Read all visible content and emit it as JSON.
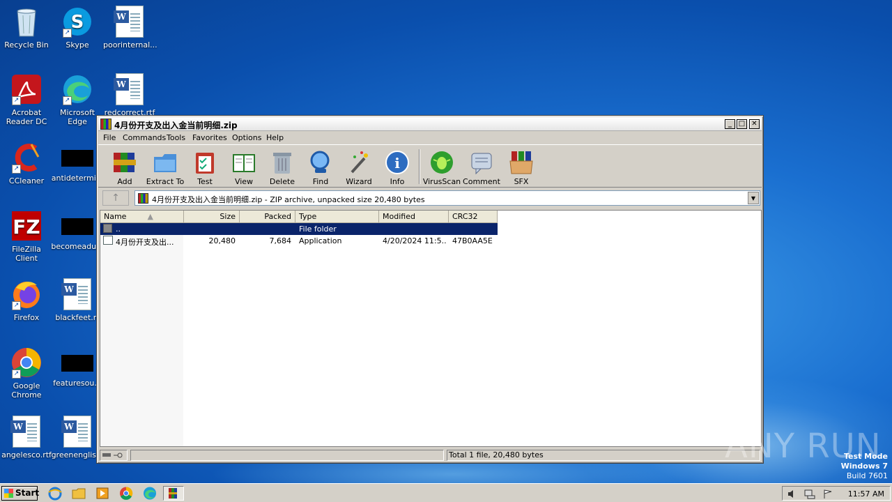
{
  "desktop": {
    "icons": [
      {
        "label": "Recycle Bin",
        "icon": "recycle-bin-icon"
      },
      {
        "label": "Skype",
        "icon": "skype-icon"
      },
      {
        "label": "poorinternal...",
        "icon": "word-document-icon"
      },
      {
        "label": "Acrobat Reader DC",
        "icon": "acrobat-icon"
      },
      {
        "label": "Microsoft Edge",
        "icon": "edge-icon"
      },
      {
        "label": "redcorrect.rtf",
        "icon": "word-document-icon"
      },
      {
        "label": "CCleaner",
        "icon": "ccleaner-icon"
      },
      {
        "label": "antidetermi...",
        "icon": "redacted-icon"
      },
      {
        "label": "FileZilla Client",
        "icon": "filezilla-icon"
      },
      {
        "label": "becomeadu...",
        "icon": "redacted-icon"
      },
      {
        "label": "Firefox",
        "icon": "firefox-icon"
      },
      {
        "label": "blackfeet.rt",
        "icon": "word-document-icon"
      },
      {
        "label": "Google Chrome",
        "icon": "chrome-icon"
      },
      {
        "label": "featuresou...",
        "icon": "redacted-icon"
      },
      {
        "label": "angelesco.rtf",
        "icon": "word-document-icon"
      },
      {
        "label": "greenenglis...",
        "icon": "word-document-icon"
      }
    ]
  },
  "window": {
    "title": "4月份开支及出入金当前明细.zip",
    "controls": {
      "minimize": "_",
      "maximize": "□",
      "close": "✕"
    },
    "menu": [
      "File",
      "Commands",
      "Tools",
      "Favorites",
      "Options",
      "Help"
    ],
    "toolbar": [
      {
        "label": "Add",
        "icon": "add-archive-icon"
      },
      {
        "label": "Extract To",
        "icon": "extract-folder-icon"
      },
      {
        "label": "Test",
        "icon": "test-clipboard-icon"
      },
      {
        "label": "View",
        "icon": "view-book-icon"
      },
      {
        "label": "Delete",
        "icon": "trash-icon"
      },
      {
        "label": "Find",
        "icon": "magnifier-icon"
      },
      {
        "label": "Wizard",
        "icon": "wand-icon"
      },
      {
        "label": "Info",
        "icon": "info-icon"
      },
      {
        "label": "VirusScan",
        "icon": "bug-icon"
      },
      {
        "label": "Comment",
        "icon": "comment-icon"
      },
      {
        "label": "SFX",
        "icon": "sfx-box-icon"
      }
    ],
    "address": "4月份开支及出入金当前明细.zip - ZIP archive, unpacked size 20,480 bytes",
    "columns": [
      "Name",
      "Size",
      "Packed",
      "Type",
      "Modified",
      "CRC32"
    ],
    "rows": [
      {
        "name": "..",
        "size": "",
        "packed": "",
        "type": "File folder",
        "modified": "",
        "crc": "",
        "selected": true
      },
      {
        "name": "4月份开支及出...",
        "size": "20,480",
        "packed": "7,684",
        "type": "Application",
        "modified": "4/20/2024 11:5...",
        "crc": "47B0AA5E",
        "selected": false
      }
    ],
    "status": "Total 1 file, 20,480 bytes"
  },
  "taskbar": {
    "start": "Start",
    "clock": "11:57 AM",
    "pinned": [
      "ie-icon",
      "explorer-icon",
      "media-player-icon",
      "chrome-icon",
      "edge-icon",
      "winrar-icon"
    ]
  },
  "overlay": {
    "watermark": "ANY RUN",
    "test_mode": "Test Mode",
    "os": "Windows 7",
    "build": "Build 7601"
  }
}
